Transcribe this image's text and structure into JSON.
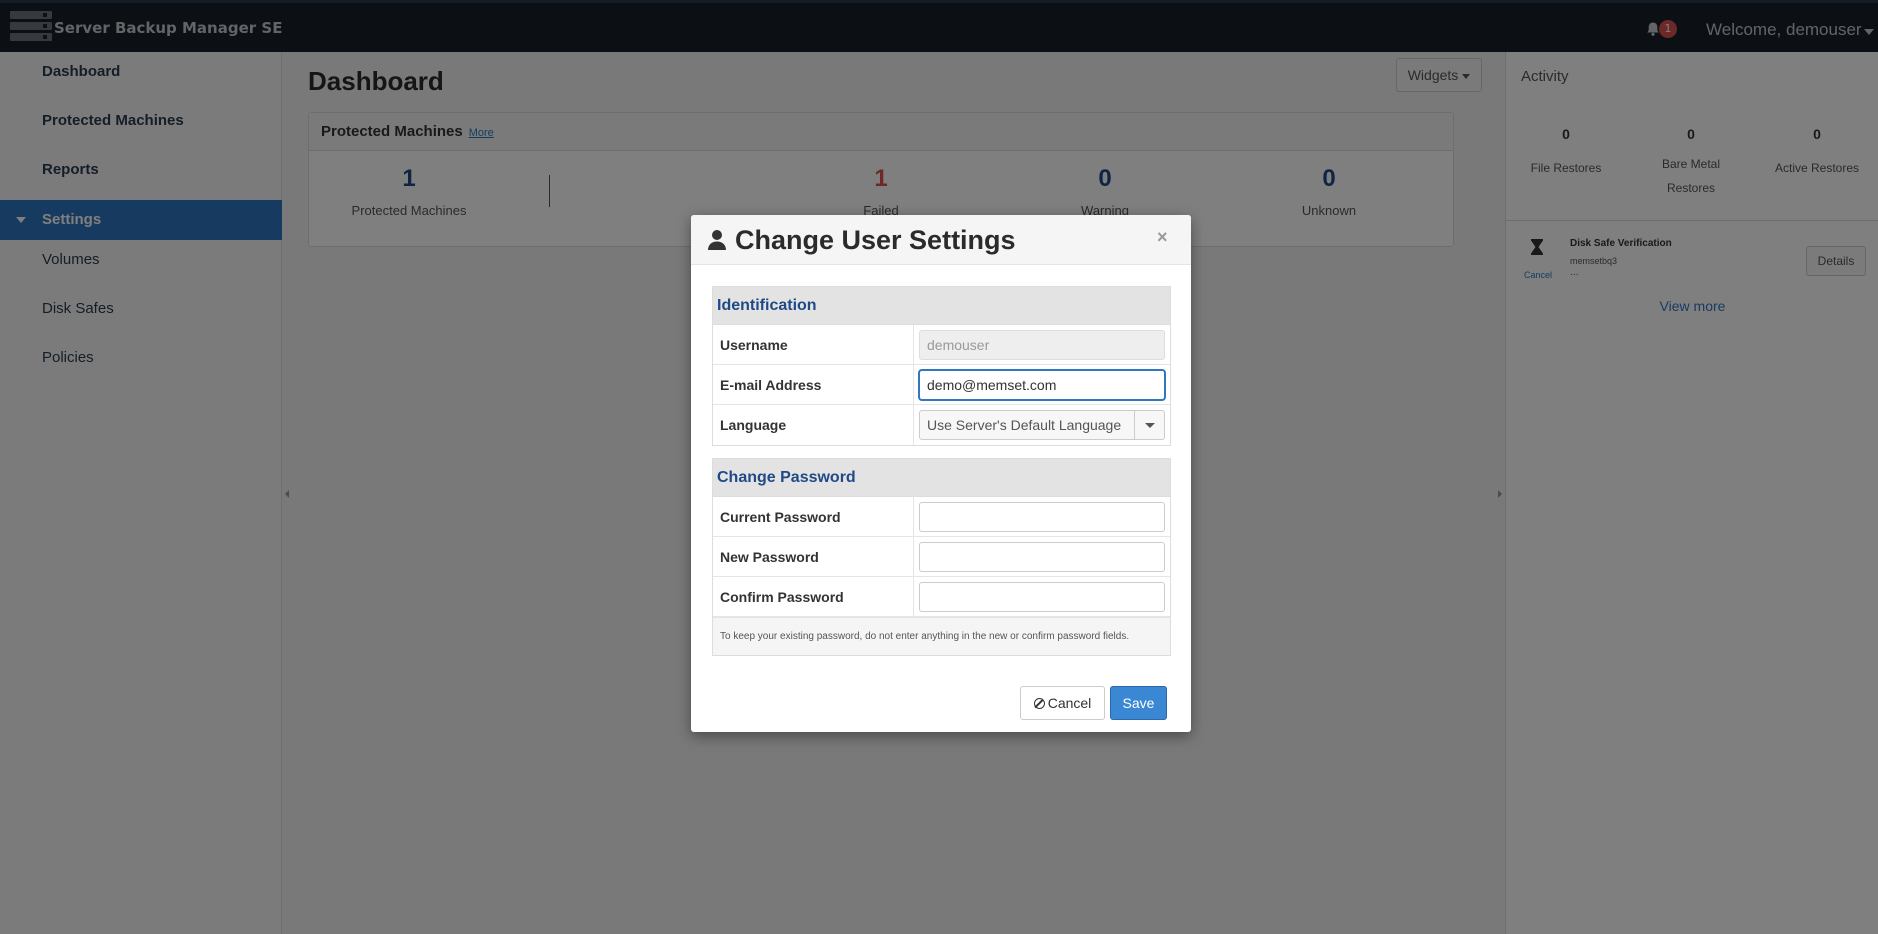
{
  "header": {
    "app_title": "Server Backup Manager SE",
    "notification_count": "1",
    "welcome": "Welcome, demouser"
  },
  "sidebar": {
    "items": [
      {
        "label": "Dashboard"
      },
      {
        "label": "Protected Machines"
      },
      {
        "label": "Reports"
      },
      {
        "label": "Settings"
      },
      {
        "label": "Volumes"
      },
      {
        "label": "Disk Safes"
      },
      {
        "label": "Policies"
      }
    ]
  },
  "main": {
    "title": "Dashboard",
    "widgets_label": "Widgets",
    "panel": {
      "title": "Protected Machines",
      "more": "More",
      "stats": [
        {
          "value": "1",
          "label": "Protected Machines"
        },
        {
          "value": "1",
          "label": "Failed"
        },
        {
          "value": "0",
          "label": "Warning"
        },
        {
          "value": "0",
          "label": "Unknown"
        }
      ]
    }
  },
  "activity": {
    "title": "Activity",
    "stats": [
      {
        "value": "0",
        "label": "File Restores"
      },
      {
        "value": "0",
        "label": "Bare Metal Restores"
      },
      {
        "value": "0",
        "label": "Active Restores"
      }
    ],
    "job": {
      "name": "Disk Safe Verification",
      "machine": "memsetbq3",
      "dots": "...",
      "cancel": "Cancel",
      "details": "Details"
    },
    "view_more": "View more"
  },
  "modal": {
    "title": "Change User Settings",
    "close": "×",
    "identification": {
      "heading": "Identification",
      "username_label": "Username",
      "username_value": "demouser",
      "email_label": "E-mail Address",
      "email_value": "demo@memset.com",
      "language_label": "Language",
      "language_value": "Use Server's Default Language"
    },
    "password": {
      "heading": "Change Password",
      "current_label": "Current Password",
      "new_label": "New Password",
      "confirm_label": "Confirm Password",
      "hint": "To keep your existing password, do not enter anything in the new or confirm password fields."
    },
    "cancel_label": "Cancel",
    "save_label": "Save"
  },
  "colors": {
    "accent": "#2f77c0",
    "topbar": "#18202b",
    "danger": "#d9534f"
  }
}
